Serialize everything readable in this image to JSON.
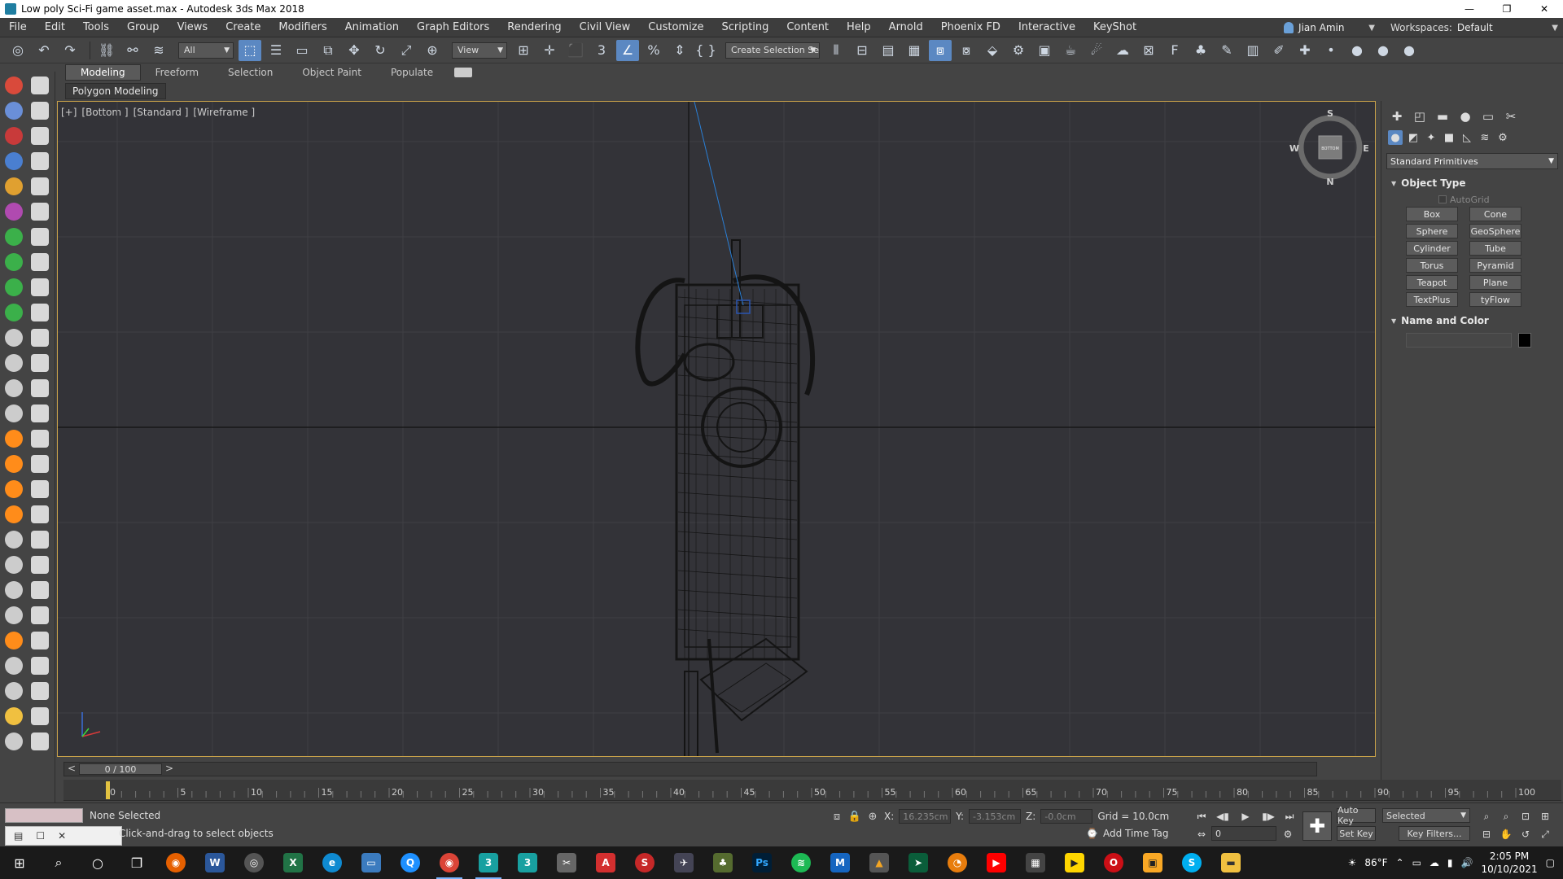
{
  "window": {
    "title": "Low poly Sci-Fi game asset.max - Autodesk 3ds Max 2018",
    "minimize": "—",
    "maximize": "❐",
    "close": "✕"
  },
  "menubar": {
    "items": [
      "File",
      "Edit",
      "Tools",
      "Group",
      "Views",
      "Create",
      "Modifiers",
      "Animation",
      "Graph Editors",
      "Rendering",
      "Civil View",
      "Customize",
      "Scripting",
      "Content",
      "Help",
      "Arnold",
      "Phoenix FD",
      "Interactive",
      "KeyShot"
    ],
    "user": "Jian Amin",
    "workspaces_label": "Workspaces:",
    "workspace": "Default"
  },
  "toolbar": {
    "filter": "All",
    "ref_coord": "View",
    "selection_set": "Create Selection Se"
  },
  "ribbon": {
    "tabs": [
      "Modeling",
      "Freeform",
      "Selection",
      "Object Paint",
      "Populate"
    ],
    "active_tab": "Modeling",
    "panel": "Polygon Modeling"
  },
  "viewport": {
    "label_plus": "[+]",
    "label_view": "[Bottom ]",
    "label_shading": "[Standard ]",
    "label_style": "[Wireframe ]",
    "viewcube": {
      "s": "S",
      "n": "N",
      "e": "E",
      "w": "W",
      "face": "BOTTOM"
    }
  },
  "command_panel": {
    "category": "Standard Primitives",
    "object_type_title": "Object Type",
    "autogrid": "AutoGrid",
    "primitives": [
      "Box",
      "Cone",
      "Sphere",
      "GeoSphere",
      "Cylinder",
      "Tube",
      "Torus",
      "Pyramid",
      "Teapot",
      "Plane",
      "TextPlus",
      "tyFlow"
    ],
    "name_color_title": "Name and Color"
  },
  "timeline": {
    "frame": "0 / 100",
    "ticks": [
      "0",
      "5",
      "10",
      "15",
      "20",
      "25",
      "30",
      "35",
      "40",
      "45",
      "50",
      "55",
      "60",
      "65",
      "70",
      "75",
      "80",
      "85",
      "90",
      "95",
      "100"
    ]
  },
  "status": {
    "selection": "None Selected",
    "prompt": "Click-and-drag to select objects",
    "x_label": "X:",
    "x_value": "16.235cm",
    "y_label": "Y:",
    "y_value": "-3.153cm",
    "z_label": "Z:",
    "z_value": "-0.0cm",
    "grid": "Grid = 10.0cm",
    "add_time_tag": "Add Time Tag",
    "auto_key": "Auto Key",
    "set_key": "Set Key",
    "key_mode": "Selected",
    "key_filters": "Key Filters...",
    "current_frame": "0"
  },
  "taskbar": {
    "weather": "86°F",
    "time": "2:05 PM",
    "date": "10/10/2021"
  },
  "colors": {
    "accent": "#5b88c2",
    "viewport_bg": "#333338",
    "viewport_border": "#c9a24a"
  }
}
